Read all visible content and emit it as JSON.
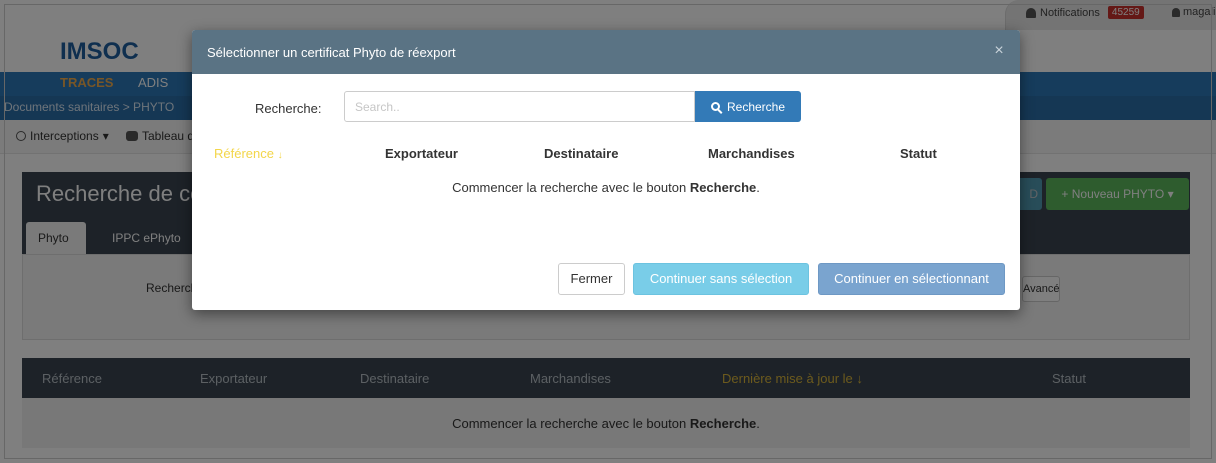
{
  "topbar": {
    "notifications_label": "Notifications",
    "notifications_count": "45259",
    "user_name": "magali"
  },
  "brand": "IMSOC",
  "nav": {
    "traces": "TRACES",
    "adis": "ADIS"
  },
  "breadcrumb": "Documents sanitaires > PHYTO",
  "toolbar": {
    "interceptions": "Interceptions",
    "tableau": "Tableau de bord"
  },
  "page": {
    "title": "Recherche de certificats PHYTO",
    "new_button": "Nouveau PHYTO",
    "tabs": [
      "Phyto",
      "IPPC ePhyto"
    ],
    "filter_label": "Recherche:",
    "advanced_button": "Avancée"
  },
  "results": {
    "columns": [
      "Référence",
      "Exportateur",
      "Destinataire",
      "Marchandises",
      "Dernière mise à jour le",
      "Statut"
    ],
    "empty_prefix": "Commencer la recherche avec le bouton ",
    "empty_bold": "Recherche",
    "empty_suffix": "."
  },
  "modal": {
    "title": "Sélectionner un certificat Phyto de réexport",
    "close_symbol": "×",
    "search_label": "Recherche:",
    "search_placeholder": "Search..",
    "search_value": "",
    "search_button": "Recherche",
    "columns": [
      "Référence",
      "Exportateur",
      "Destinataire",
      "Marchandises",
      "Statut"
    ],
    "empty_prefix": "Commencer la recherche avec le bouton ",
    "empty_bold": "Recherche",
    "empty_suffix": ".",
    "buttons": {
      "close": "Fermer",
      "continue_no_selection": "Continuer sans sélection",
      "continue_selecting": "Continuer en sélectionnant"
    }
  },
  "icons": {
    "bell": "bell-icon",
    "user": "user-icon",
    "interceptions": "hand-icon",
    "tableau": "cogs-icon",
    "sort": "sort-icon",
    "search": "search-icon",
    "close": "close-icon"
  },
  "colors": {
    "brand_blue": "#1f5f9e",
    "nav_blue": "#2c78b8",
    "modal_header": "#5a7384",
    "primary": "#337ab7",
    "info": "#5bc0de",
    "success": "#5cb85c",
    "sorted_column": "#f3d64a"
  }
}
